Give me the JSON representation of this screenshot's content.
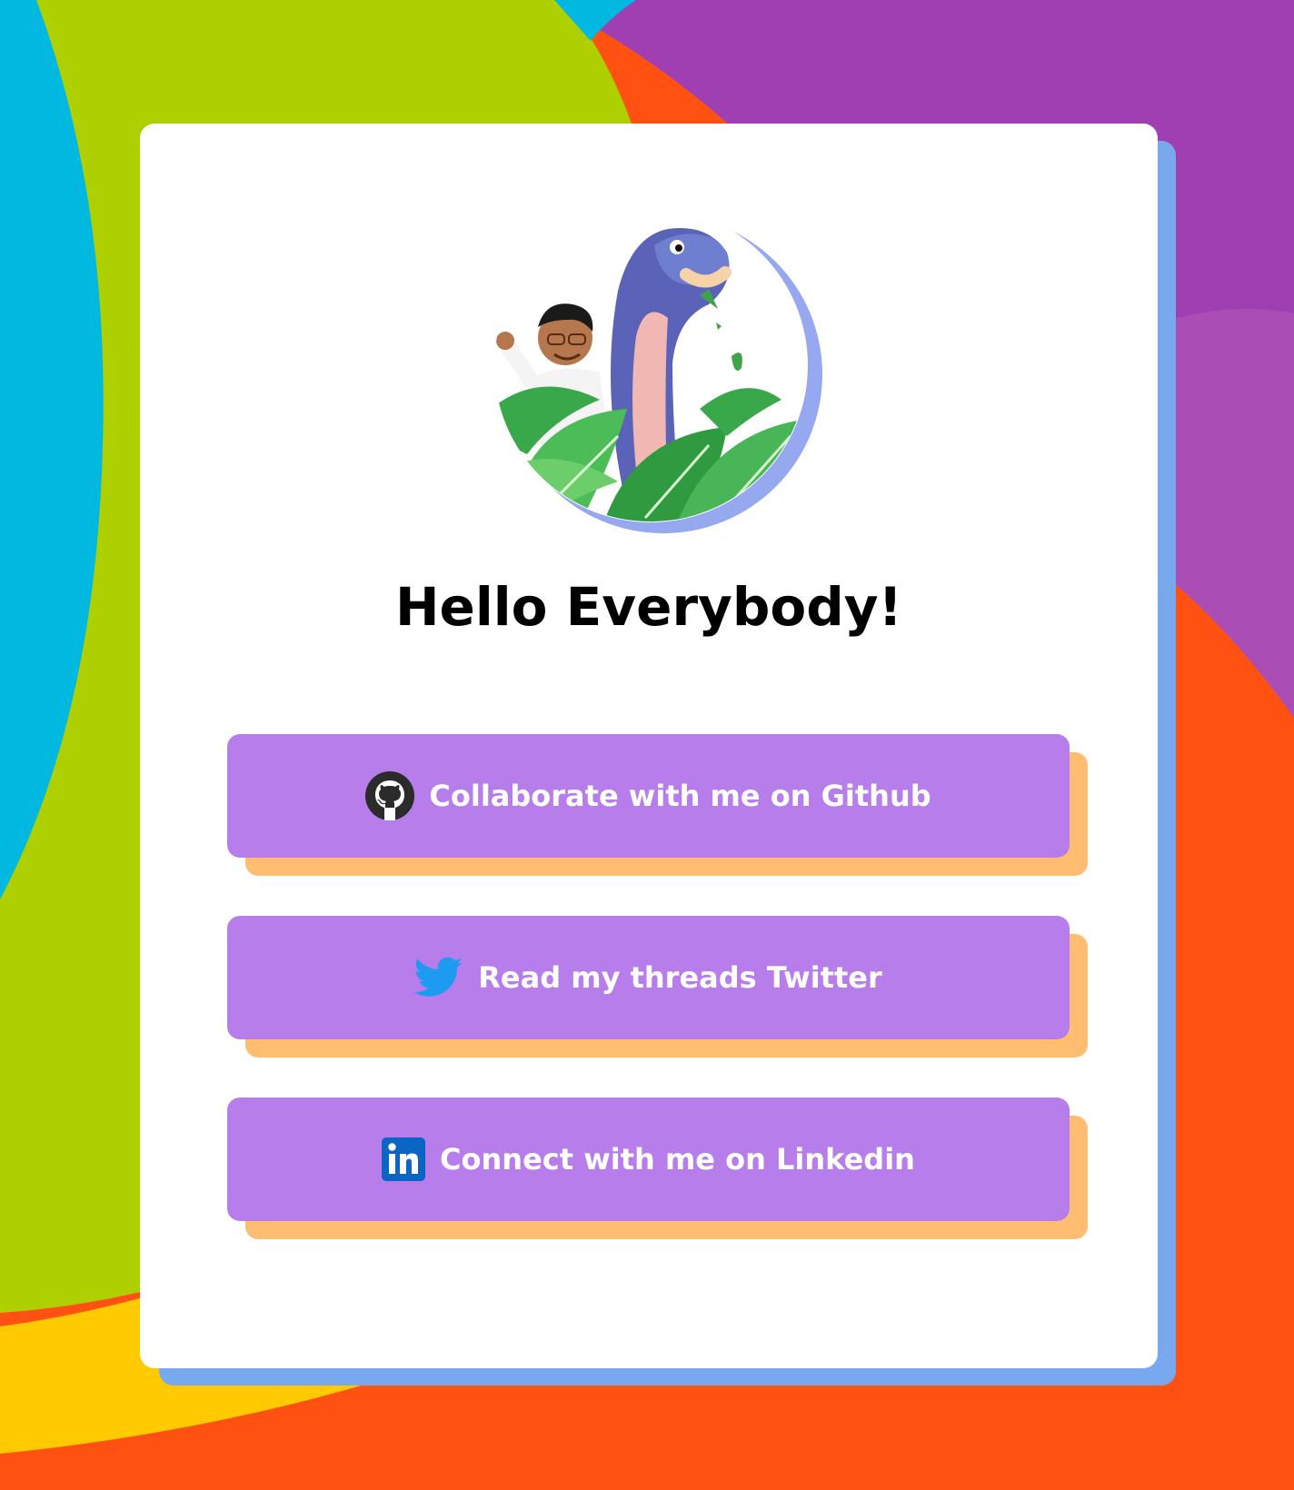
{
  "page": {
    "heading": "Hello Everybody!"
  },
  "links": [
    {
      "label": "Collaborate with me on Github",
      "icon": "github-icon"
    },
    {
      "label": "Read my threads Twitter",
      "icon": "twitter-icon"
    },
    {
      "label": "Connect with me on Linkedin",
      "icon": "linkedin-icon"
    }
  ],
  "colors": {
    "button": "#b67deb",
    "button_shadow": "#ffbd72",
    "card_shadow": "#78a9ee",
    "bg_cyan": "#00b8e0",
    "bg_green": "#aed000",
    "bg_purple": "#a03fb2",
    "bg_orange": "#ff5212",
    "bg_yellow": "#ffca00",
    "twitter_blue": "#1d9bf0",
    "linkedin_blue": "#0a66c2"
  }
}
